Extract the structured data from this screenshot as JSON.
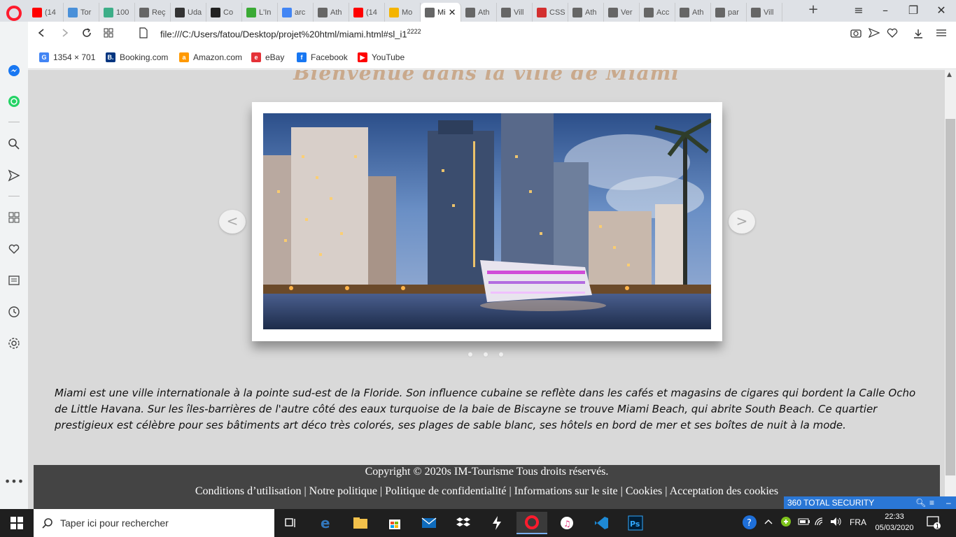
{
  "tabs": [
    {
      "label": "(14",
      "color": "#ff0000",
      "icon": "youtube-icon"
    },
    {
      "label": "Tor",
      "color": "#4a90d9",
      "icon": "tg-icon"
    },
    {
      "label": "100",
      "color": "#3dae88",
      "icon": "d-icon"
    },
    {
      "label": "Reç",
      "color": "#666666",
      "icon": "file-icon"
    },
    {
      "label": "Uda",
      "color": "#333333",
      "icon": "udemy-icon"
    },
    {
      "label": "Co",
      "color": "#222222",
      "icon": "codepen-icon"
    },
    {
      "label": "L'In",
      "color": "#3aaa35",
      "icon": "px-icon"
    },
    {
      "label": "arc",
      "color": "#4285f4",
      "icon": "google-icon"
    },
    {
      "label": "Ath",
      "color": "#666666",
      "icon": "file-icon"
    },
    {
      "label": "(14",
      "color": "#ff0000",
      "icon": "youtube-icon"
    },
    {
      "label": "Mo",
      "color": "#f4b400",
      "icon": "drive-icon"
    },
    {
      "label": "Mi",
      "color": "#666666",
      "icon": "file-icon",
      "active": true
    },
    {
      "label": "Ath",
      "color": "#666666",
      "icon": "file-icon"
    },
    {
      "label": "Vill",
      "color": "#666666",
      "icon": "file-icon"
    },
    {
      "label": "CSS",
      "color": "#d32f2f",
      "icon": "css-icon"
    },
    {
      "label": "Ath",
      "color": "#666666",
      "icon": "file-icon"
    },
    {
      "label": "Ver",
      "color": "#666666",
      "icon": "file-icon"
    },
    {
      "label": "Acc",
      "color": "#666666",
      "icon": "grid-icon"
    },
    {
      "label": "Ath",
      "color": "#666666",
      "icon": "file-icon"
    },
    {
      "label": "par",
      "color": "#666666",
      "icon": "file-icon"
    },
    {
      "label": "Vill",
      "color": "#666666",
      "icon": "file-icon"
    }
  ],
  "address": {
    "url": "file:///C:/Users/fatou/Desktop/projet%20html/miami.html#sl_i1",
    "url_suffix": "2222"
  },
  "bookmarks": [
    {
      "label": "1354 × 701",
      "color": "#4285f4",
      "glyph": "G"
    },
    {
      "label": "Booking.com",
      "color": "#003580",
      "glyph": "B."
    },
    {
      "label": "Amazon.com",
      "color": "#ff9900",
      "glyph": "a"
    },
    {
      "label": "eBay",
      "color": "#e53238",
      "glyph": "e"
    },
    {
      "label": "Facebook",
      "color": "#1877f2",
      "glyph": "f"
    },
    {
      "label": "YouTube",
      "color": "#ff0000",
      "glyph": "▶"
    }
  ],
  "page": {
    "heading": "Bienvenue dans la ville de Miami",
    "prev_label": "<",
    "next_label": ">",
    "intro": "Miami est une ville internationale à la pointe sud-est de la Floride. Son influence cubaine se reflète dans les cafés et magasins de cigares qui bordent la Calle Ocho de Little Havana. Sur les îles-barrières de l'autre côté des eaux turquoise de la baie de Biscayne se trouve Miami Beach, qui abrite South Beach. Ce quartier prestigieux est célèbre pour ses bâtiments art déco très colorés, ses plages de sable blanc, ses hôtels en bord de mer et ses boîtes de nuit à la mode.",
    "footer_copyright": "Copyright © 2020s IM-Tourisme Tous droits réservés.",
    "footer_links": [
      "Conditions d’utilisation",
      "Notre politique",
      "Politique de confidentialité",
      "Informations sur le site",
      "Cookies",
      "Acceptation des cookies"
    ]
  },
  "security_widget": {
    "label": "360 TOTAL SECURITY"
  },
  "taskbar": {
    "search_placeholder": "Taper ici pour rechercher",
    "lang": "FRA",
    "time": "22:33",
    "date": "05/03/2020",
    "notif_count": "1"
  },
  "colors": {
    "page_bg": "#d9d9d9",
    "heading": "#c9a98c",
    "footer_bg": "#444444",
    "accent_blue": "#2a77d6"
  }
}
